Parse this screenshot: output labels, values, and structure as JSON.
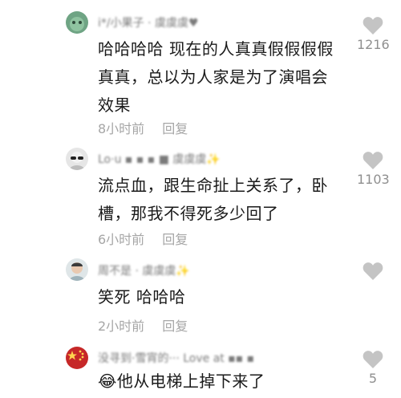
{
  "comments": [
    {
      "username": "i*/小果子 · 虞虞虞♥",
      "text": "哈哈哈哈 现在的人真真假假假假真真，总以为人家是为了演唱会效果",
      "time": "8小时前",
      "reply": "回复",
      "likes": "1216",
      "avatar_color": "#5f8f72"
    },
    {
      "username": "Lo·u ▪ ▪ ▪ ■ 虞虞虞✨",
      "text": "流点血，跟生命扯上关系了，卧槽，那我不得死多少回了",
      "time": "6小时前",
      "reply": "回复",
      "likes": "1103",
      "avatar_color": "#cfcfcf"
    },
    {
      "username": "周不是 · 虞虞虞✨",
      "text": "笑死 哈哈哈",
      "time": "2小时前",
      "reply": "回复",
      "likes": "",
      "avatar_color": "#b7c6cc"
    },
    {
      "username": "没寻到·雪宵的··· Love at ▪▪ ▪",
      "text": "😂他从电梯上掉下来了",
      "time": "",
      "reply": "",
      "likes": "5",
      "avatar_color": "#c62828"
    }
  ],
  "colors": {
    "text": "#1a1a1a",
    "meta": "#a6a6a6",
    "heart": "#c4c4c4"
  }
}
